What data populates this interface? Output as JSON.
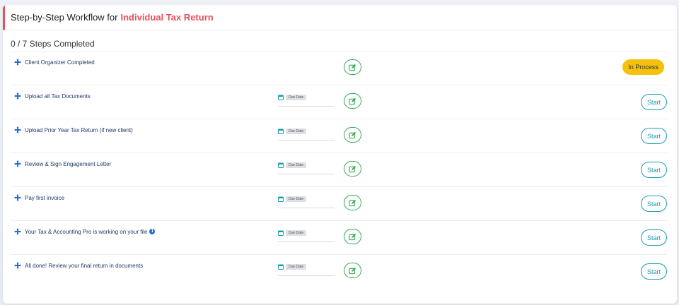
{
  "header": {
    "title_prefix": "Step-by-Step Workflow for",
    "title_accent": "Individual Tax Return"
  },
  "progress_text": "0 / 7 Steps Completed",
  "due_label": "Due Date",
  "colors": {
    "accent": "#e8505b",
    "edit_green": "#2fa84f",
    "start_teal": "#1a9bb0",
    "status_yellow": "#f4c20d",
    "title_navy": "#1e3a66"
  },
  "steps": [
    {
      "title": "Client Organizer Completed",
      "status": "In Process"
    },
    {
      "title": "Upload all Tax Documents",
      "action": "Start"
    },
    {
      "title": "Upload Prior Year Tax Return (if new client)",
      "action": "Start"
    },
    {
      "title": "Review & Sign Engagement Letter",
      "action": "Start"
    },
    {
      "title": "Pay first invoice",
      "action": "Start"
    },
    {
      "title": "Your Tax & Accounting Pro is working on your file",
      "info_icon": "info-icon",
      "action": "Start"
    },
    {
      "title": "All done! Review your final return in documents",
      "action": "Start"
    }
  ]
}
